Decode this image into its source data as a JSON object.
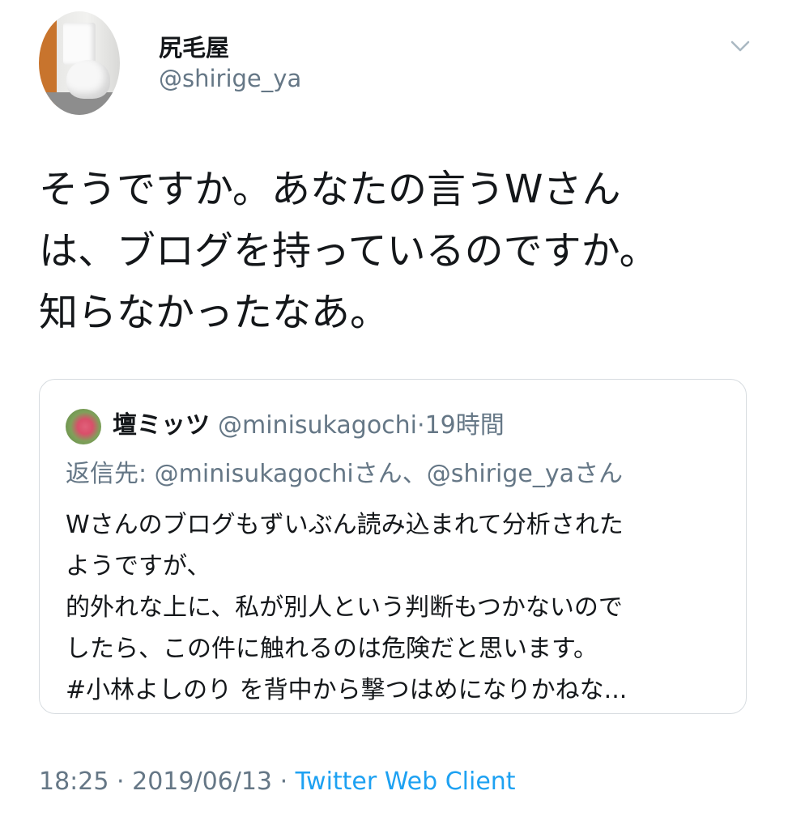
{
  "author": {
    "display_name": "尻毛屋",
    "handle": "@shirige_ya"
  },
  "tweet": {
    "lines": [
      "そうですか。あなたの言うWさん",
      "は、ブログを持っているのですか。",
      "知らなかったなあ。"
    ]
  },
  "quoted_tweet": {
    "display_name": "壇ミッツ",
    "handle": "@minisukagochi",
    "separator": "·",
    "time_ago": "19時間",
    "reply_prefix": "返信先: ",
    "reply_to": [
      {
        "handle": "@minisukagochi",
        "suffix": "さん"
      },
      {
        "handle": "@shirige_ya",
        "suffix": "さん"
      }
    ],
    "reply_joiner": "、",
    "body_lines": [
      "Wさんのブログもずいぶん読み込まれて分析された",
      "ようですが、",
      "的外れな上に、私が別人という判断もつかないので",
      "したら、この件に触れるのは危険だと思います。",
      "#小林よしのり を背中から撃つはめになりかねな..."
    ]
  },
  "meta": {
    "time": "18:25",
    "separator": "·",
    "date": "2019/06/13",
    "client": "Twitter Web Client"
  },
  "icons": {
    "menu": "chevron-down-icon"
  },
  "colors": {
    "text_primary": "#14171a",
    "text_secondary": "#657786",
    "link": "#1da1f2",
    "border": "#d7dce0"
  }
}
